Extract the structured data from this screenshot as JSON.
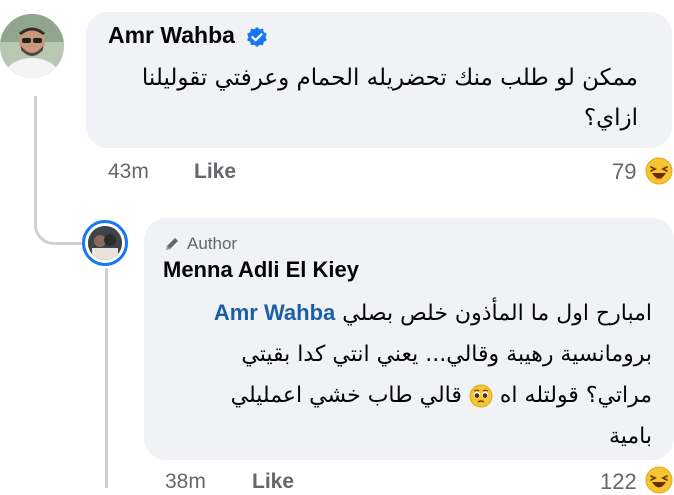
{
  "comment": {
    "author": "Amr Wahba",
    "verified_icon": "verified-badge-icon",
    "text_line1": "ممكن لو طلب منك تحضريله الحمام وعرفتي تقوليلنا",
    "text_line2": "ازاي؟",
    "time": "43m",
    "like_label": "Like",
    "reaction_count": "79",
    "reaction_icon": "haha-emoji-icon"
  },
  "reply": {
    "badge_label": "Author",
    "badge_icon": "pencil-icon",
    "author": "Menna Adli El Kiey",
    "mention": "Amr Wahba",
    "line1_rest": "امبارح اول ما المأذون خلص بصلي",
    "line2": "برومانسية رهيبة وقالي... يعني انتي كدا بقيتي",
    "line3_a": "مراتي؟ قولتله اه",
    "line3_b": "قالي طاب خشي اعمليلي",
    "line4": "بامية",
    "inline_emoji": "pleading-face-icon",
    "time": "38m",
    "like_label": "Like",
    "reaction_count": "122",
    "reaction_icon": "haha-emoji-icon"
  },
  "colors": {
    "bubble": "#f0f2f5",
    "mention": "#1b5ea8",
    "meta": "#65676b",
    "verified": "#1877f2",
    "thread_line": "#ced0d4"
  }
}
